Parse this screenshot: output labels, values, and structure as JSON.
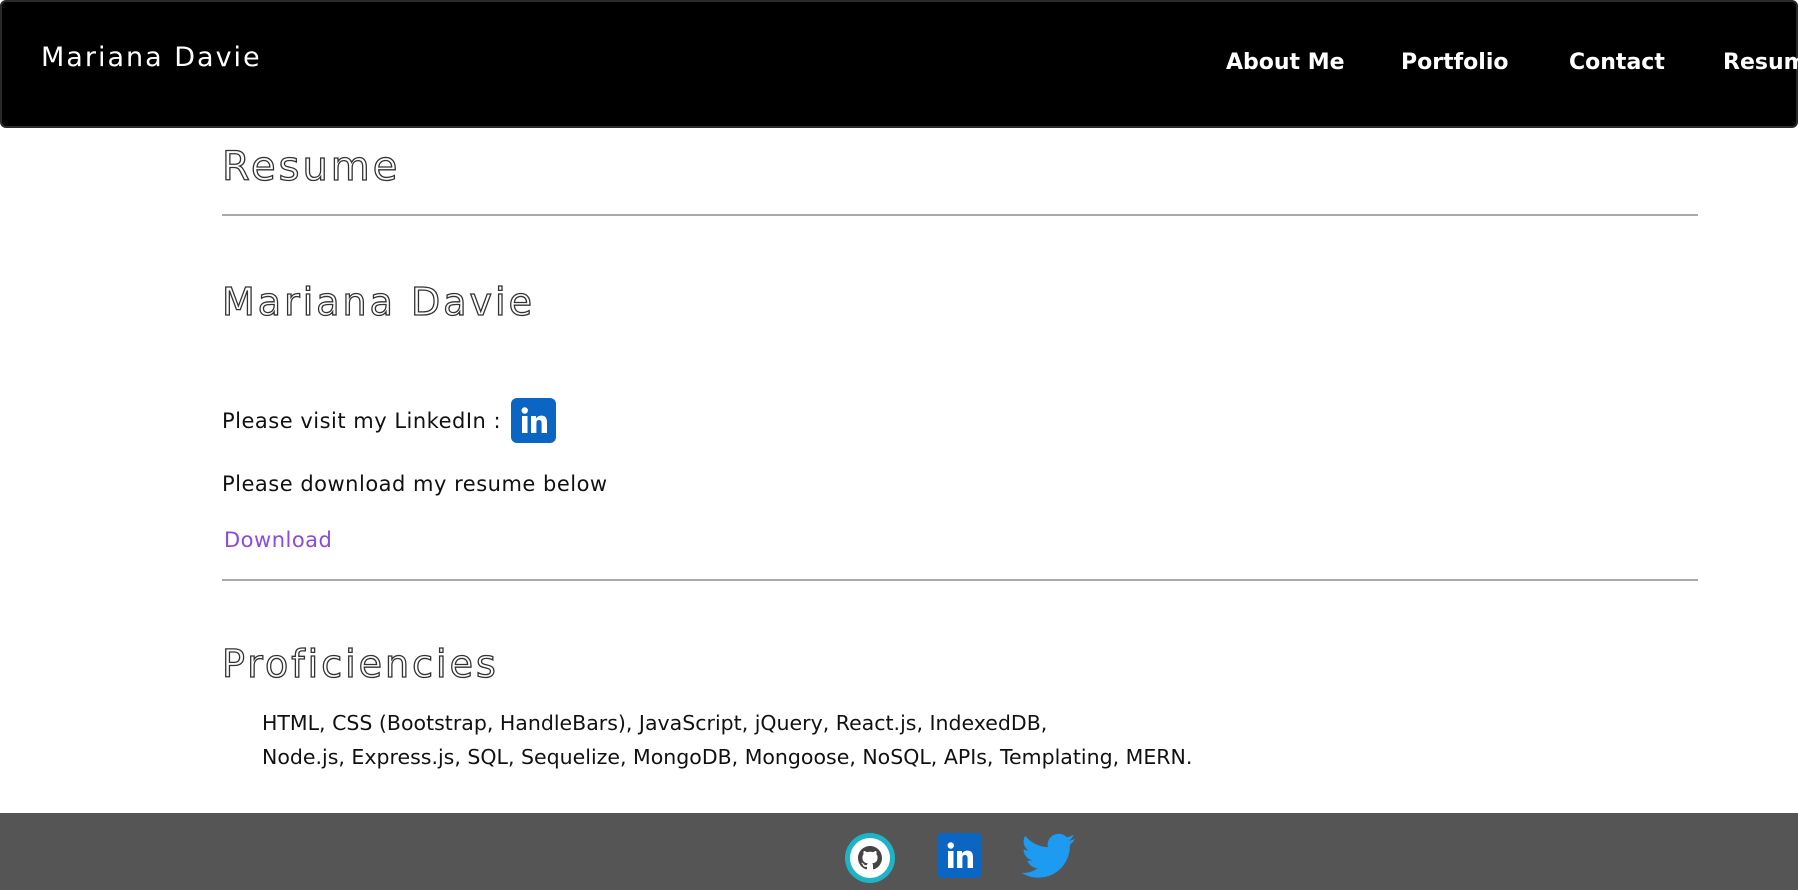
{
  "navbar": {
    "brand": "Mariana Davie",
    "links": [
      {
        "label": "About Me"
      },
      {
        "label": "Portfolio"
      },
      {
        "label": "Contact"
      },
      {
        "label": "Resume"
      }
    ],
    "background": "#000000"
  },
  "main": {
    "page_title": "Resume",
    "name": "Mariana Davie",
    "linkedin_prompt": "Please visit my LinkedIn :",
    "linkedin_icon": "linkedin-icon",
    "download_prompt": "Please download my resume below",
    "download_label": "Download",
    "download_color": "#8a4bdf",
    "proficiencies_title": "Proficiencies",
    "proficiencies_line1": "HTML, CSS (Bootstrap, HandleBars), JavaScript, jQuery, React.js, IndexedDB,",
    "proficiencies_line2": "Node.js, Express.js, SQL, Sequelize, MongoDB, Mongoose, NoSQL, APIs, Templating, MERN."
  },
  "footer": {
    "background": "#555555",
    "icons": [
      "github-icon",
      "linkedin-icon",
      "twitter-icon"
    ]
  }
}
